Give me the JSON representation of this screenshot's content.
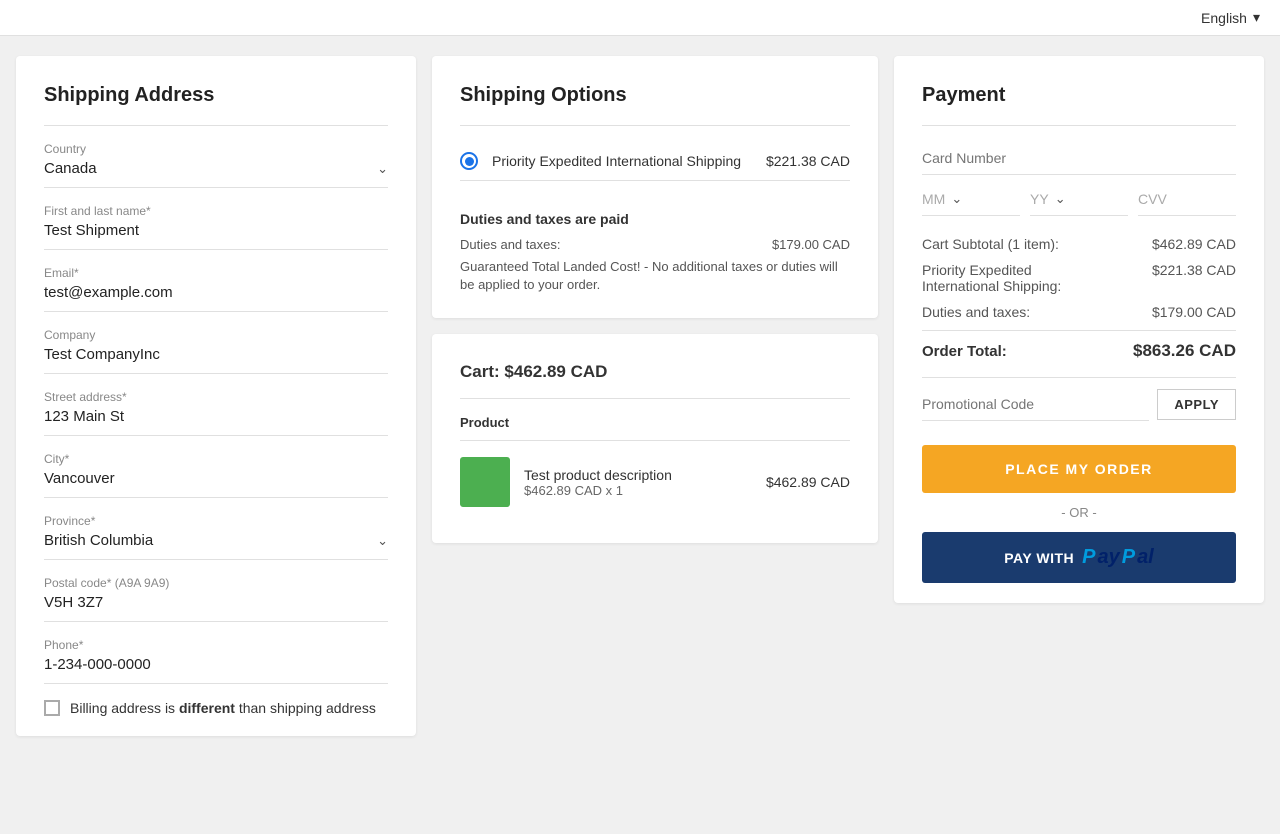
{
  "topbar": {
    "language_label": "English",
    "chevron": "▾"
  },
  "shipping_address": {
    "title": "Shipping Address",
    "country_label": "Country",
    "country_value": "Canada",
    "name_label": "First and last name*",
    "name_value": "Test Shipment",
    "email_label": "Email*",
    "email_value": "test@example.com",
    "company_label": "Company",
    "company_value": "Test CompanyInc",
    "street_label": "Street address*",
    "street_value": "123 Main St",
    "city_label": "City*",
    "city_value": "Vancouver",
    "province_label": "Province*",
    "province_value": "British Columbia",
    "postal_label": "Postal code* (A9A 9A9)",
    "postal_value": "V5H 3Z7",
    "phone_label": "Phone*",
    "phone_value": "1-234-000-0000",
    "billing_checkbox_label": "Billing address is ",
    "billing_different": "different",
    "billing_suffix": " than shipping address"
  },
  "shipping_options": {
    "title": "Shipping Options",
    "option1_label": "Priority Expedited International Shipping",
    "option1_price": "$221.38 CAD",
    "duties_title": "Duties and taxes are paid",
    "duties_label": "Duties and taxes:",
    "duties_value": "$179.00 CAD",
    "duties_note": "Guaranteed Total Landed Cost! - No additional taxes or duties will be applied to your order."
  },
  "cart": {
    "title": "Cart: ",
    "total": "$462.89 CAD",
    "column_header": "Product",
    "product_desc": "Test product description",
    "product_price": "$462.89 CAD",
    "product_qty": "$462.89 CAD x 1"
  },
  "payment": {
    "title": "Payment",
    "card_number_placeholder": "Card Number",
    "mm_label": "MM",
    "yy_label": "YY",
    "cvv_label": "CVV",
    "subtotal_label": "Cart Subtotal (1 item):",
    "subtotal_value": "$462.89 CAD",
    "shipping_label": "Priority Expedited International Shipping:",
    "shipping_value": "$221.38 CAD",
    "duties_label": "Duties and taxes:",
    "duties_value": "$179.00 CAD",
    "order_total_label": "Order Total:",
    "order_total_value": "$863.26 CAD",
    "promo_placeholder": "Promotional Code",
    "apply_btn": "APPLY",
    "place_order_btn": "PLACE MY ORDER",
    "or_text": "- OR -",
    "paypal_text": "PAY WITH",
    "paypal_logo": "PayPal"
  }
}
